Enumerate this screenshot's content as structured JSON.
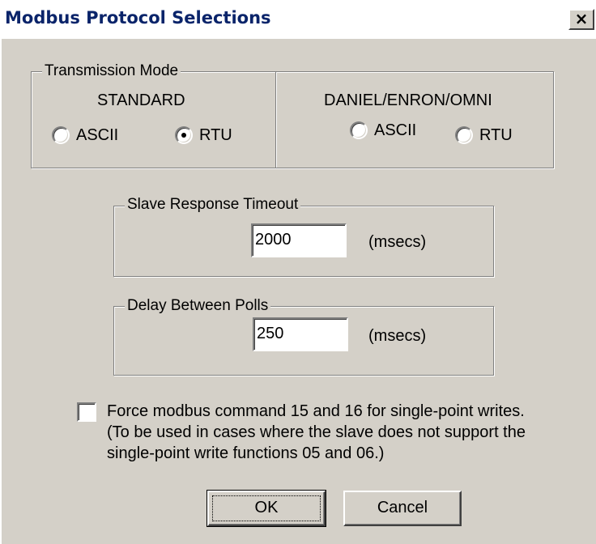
{
  "window": {
    "title": "Modbus Protocol Selections",
    "close_icon": "close-icon",
    "close_glyph": "×"
  },
  "transmission_mode": {
    "label": "Transmission Mode",
    "standard": {
      "heading": "STANDARD",
      "ascii_label": "ASCII",
      "rtu_label": "RTU",
      "selected": "RTU"
    },
    "daniel": {
      "heading": "DANIEL/ENRON/OMNI",
      "ascii_label": "ASCII",
      "rtu_label": "RTU",
      "selected": null
    }
  },
  "slave_response_timeout": {
    "label": "Slave Response Timeout",
    "value": "2000",
    "unit": "(msecs)"
  },
  "delay_between_polls": {
    "label": "Delay Between Polls",
    "value": "250",
    "unit": "(msecs)"
  },
  "force_command": {
    "checked": false,
    "line1": "Force modbus command 15 and 16 for single-point writes.",
    "line2": "(To be used in cases where the slave does not support the",
    "line3": "single-point write functions 05 and 06.)"
  },
  "buttons": {
    "ok_label": "OK",
    "cancel_label": "Cancel"
  }
}
